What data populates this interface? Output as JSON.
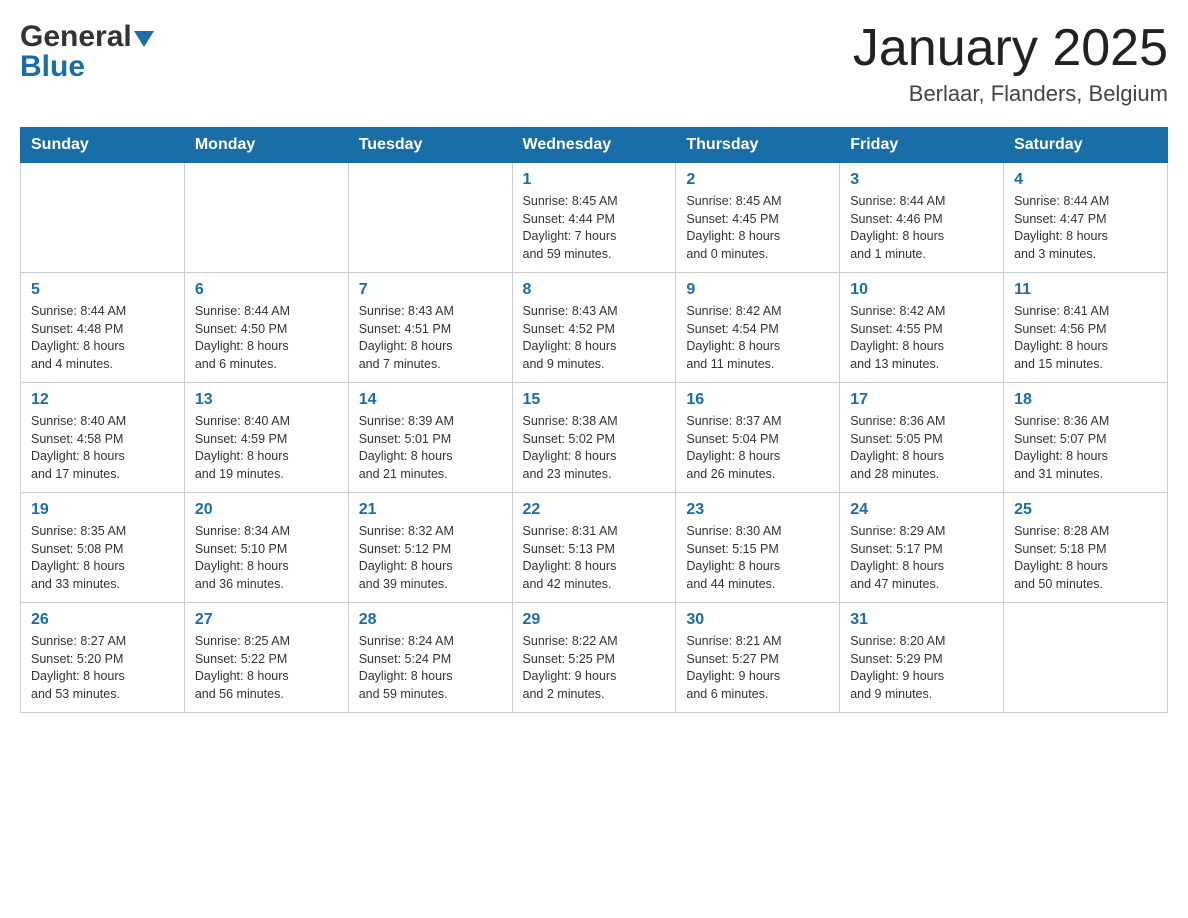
{
  "header": {
    "logo": {
      "general_text": "General",
      "blue_text": "Blue"
    },
    "title": "January 2025",
    "location": "Berlaar, Flanders, Belgium"
  },
  "weekdays": [
    "Sunday",
    "Monday",
    "Tuesday",
    "Wednesday",
    "Thursday",
    "Friday",
    "Saturday"
  ],
  "weeks": [
    [
      {
        "day": "",
        "info": ""
      },
      {
        "day": "",
        "info": ""
      },
      {
        "day": "",
        "info": ""
      },
      {
        "day": "1",
        "info": "Sunrise: 8:45 AM\nSunset: 4:44 PM\nDaylight: 7 hours\nand 59 minutes."
      },
      {
        "day": "2",
        "info": "Sunrise: 8:45 AM\nSunset: 4:45 PM\nDaylight: 8 hours\nand 0 minutes."
      },
      {
        "day": "3",
        "info": "Sunrise: 8:44 AM\nSunset: 4:46 PM\nDaylight: 8 hours\nand 1 minute."
      },
      {
        "day": "4",
        "info": "Sunrise: 8:44 AM\nSunset: 4:47 PM\nDaylight: 8 hours\nand 3 minutes."
      }
    ],
    [
      {
        "day": "5",
        "info": "Sunrise: 8:44 AM\nSunset: 4:48 PM\nDaylight: 8 hours\nand 4 minutes."
      },
      {
        "day": "6",
        "info": "Sunrise: 8:44 AM\nSunset: 4:50 PM\nDaylight: 8 hours\nand 6 minutes."
      },
      {
        "day": "7",
        "info": "Sunrise: 8:43 AM\nSunset: 4:51 PM\nDaylight: 8 hours\nand 7 minutes."
      },
      {
        "day": "8",
        "info": "Sunrise: 8:43 AM\nSunset: 4:52 PM\nDaylight: 8 hours\nand 9 minutes."
      },
      {
        "day": "9",
        "info": "Sunrise: 8:42 AM\nSunset: 4:54 PM\nDaylight: 8 hours\nand 11 minutes."
      },
      {
        "day": "10",
        "info": "Sunrise: 8:42 AM\nSunset: 4:55 PM\nDaylight: 8 hours\nand 13 minutes."
      },
      {
        "day": "11",
        "info": "Sunrise: 8:41 AM\nSunset: 4:56 PM\nDaylight: 8 hours\nand 15 minutes."
      }
    ],
    [
      {
        "day": "12",
        "info": "Sunrise: 8:40 AM\nSunset: 4:58 PM\nDaylight: 8 hours\nand 17 minutes."
      },
      {
        "day": "13",
        "info": "Sunrise: 8:40 AM\nSunset: 4:59 PM\nDaylight: 8 hours\nand 19 minutes."
      },
      {
        "day": "14",
        "info": "Sunrise: 8:39 AM\nSunset: 5:01 PM\nDaylight: 8 hours\nand 21 minutes."
      },
      {
        "day": "15",
        "info": "Sunrise: 8:38 AM\nSunset: 5:02 PM\nDaylight: 8 hours\nand 23 minutes."
      },
      {
        "day": "16",
        "info": "Sunrise: 8:37 AM\nSunset: 5:04 PM\nDaylight: 8 hours\nand 26 minutes."
      },
      {
        "day": "17",
        "info": "Sunrise: 8:36 AM\nSunset: 5:05 PM\nDaylight: 8 hours\nand 28 minutes."
      },
      {
        "day": "18",
        "info": "Sunrise: 8:36 AM\nSunset: 5:07 PM\nDaylight: 8 hours\nand 31 minutes."
      }
    ],
    [
      {
        "day": "19",
        "info": "Sunrise: 8:35 AM\nSunset: 5:08 PM\nDaylight: 8 hours\nand 33 minutes."
      },
      {
        "day": "20",
        "info": "Sunrise: 8:34 AM\nSunset: 5:10 PM\nDaylight: 8 hours\nand 36 minutes."
      },
      {
        "day": "21",
        "info": "Sunrise: 8:32 AM\nSunset: 5:12 PM\nDaylight: 8 hours\nand 39 minutes."
      },
      {
        "day": "22",
        "info": "Sunrise: 8:31 AM\nSunset: 5:13 PM\nDaylight: 8 hours\nand 42 minutes."
      },
      {
        "day": "23",
        "info": "Sunrise: 8:30 AM\nSunset: 5:15 PM\nDaylight: 8 hours\nand 44 minutes."
      },
      {
        "day": "24",
        "info": "Sunrise: 8:29 AM\nSunset: 5:17 PM\nDaylight: 8 hours\nand 47 minutes."
      },
      {
        "day": "25",
        "info": "Sunrise: 8:28 AM\nSunset: 5:18 PM\nDaylight: 8 hours\nand 50 minutes."
      }
    ],
    [
      {
        "day": "26",
        "info": "Sunrise: 8:27 AM\nSunset: 5:20 PM\nDaylight: 8 hours\nand 53 minutes."
      },
      {
        "day": "27",
        "info": "Sunrise: 8:25 AM\nSunset: 5:22 PM\nDaylight: 8 hours\nand 56 minutes."
      },
      {
        "day": "28",
        "info": "Sunrise: 8:24 AM\nSunset: 5:24 PM\nDaylight: 8 hours\nand 59 minutes."
      },
      {
        "day": "29",
        "info": "Sunrise: 8:22 AM\nSunset: 5:25 PM\nDaylight: 9 hours\nand 2 minutes."
      },
      {
        "day": "30",
        "info": "Sunrise: 8:21 AM\nSunset: 5:27 PM\nDaylight: 9 hours\nand 6 minutes."
      },
      {
        "day": "31",
        "info": "Sunrise: 8:20 AM\nSunset: 5:29 PM\nDaylight: 9 hours\nand 9 minutes."
      },
      {
        "day": "",
        "info": ""
      }
    ]
  ]
}
